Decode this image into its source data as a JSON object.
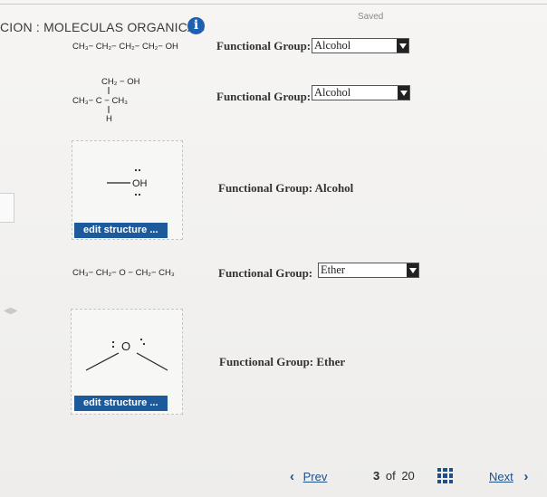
{
  "header": {
    "saved": "Saved",
    "title": "CION : MOLECULAS ORGANICAS",
    "info_icon": "info-icon"
  },
  "q1": {
    "formula": "CH₃− CH₂− CH₂− CH₂− OH",
    "label": "Functional Group:",
    "selected": "Alcohol"
  },
  "q2": {
    "top": "CH₂ − OH",
    "mid": "CH₃− C − CH₃",
    "bottom": "H",
    "label": "Functional Group:",
    "selected": "Alcohol"
  },
  "q3": {
    "oh": "OH",
    "label": "Functional Group: Alcohol",
    "edit": "edit structure ..."
  },
  "q4": {
    "formula": "CH₃− CH₂− O − CH₂− CH₃",
    "label": "Functional Group:",
    "selected": "Ether"
  },
  "q5": {
    "o": "O",
    "label": "Functional Group: Ether",
    "edit": "edit structure ..."
  },
  "pager": {
    "prev": "Prev",
    "current": "3",
    "of": "of",
    "total": "20",
    "next": "Next",
    "grid_icon": "grid-icon"
  }
}
